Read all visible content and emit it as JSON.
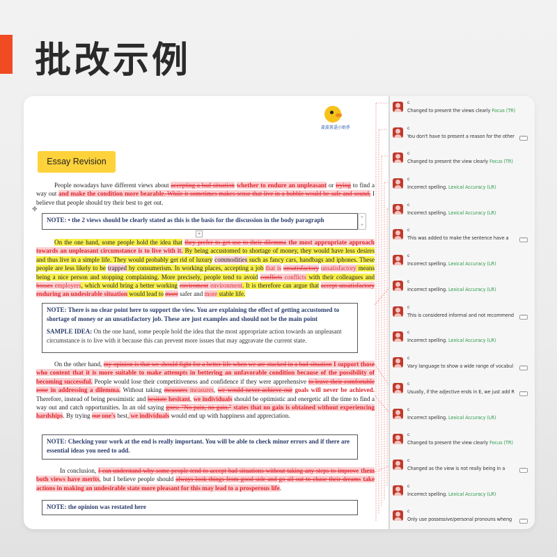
{
  "page_title": "批改示例",
  "colors": {
    "accent": "#f04b23",
    "deleted_text": "#e0232b",
    "highlight": "#f8f04a",
    "tag_green": "#2d9b4b",
    "tag_yellow": "#fed23a"
  },
  "logo": {
    "text": "皮皮英语小助手",
    "icon": "duck-mascot-icon"
  },
  "essay_tag": "Essay Revision",
  "doc": {
    "p1": {
      "a": "People nowadays have different views about",
      "d1": "accepting a bad situation",
      "i1": "whether to endure an unpleasant",
      "b": " or",
      "d2": "trying",
      "c": " to find a way out",
      "i2": "and make the condition more bearable",
      "d3": ". While it sometimes makes sense that live in a bubble would be safe and sound,",
      "e": " I believe that people should try their best to get out."
    },
    "note1": "NOTE: • the 2 views should be clearly stated as this is the basis for the discussion in the body paragraph",
    "p2": {
      "a": "On the one hand, some people hold the idea that",
      "d1": "they prefer to get use to their dilemma",
      "i1": " the most appropriate approach towards an unpleasant circumstance is to live with it.",
      "b": " By being accustomed to shortage of money, they would have less desires and thus live in a simple life. They would probably get rid of luxury",
      "d2": "commodities",
      "c": " such as fancy cars, handbags and iphones. These people are less likely to be",
      "d3": "trapped",
      "e": " by consumerism. In working places, accepting a job",
      "i2": "that is",
      "d4": "unsatisfactory",
      "i3": "unsatisfactory",
      "f": " means being a nice person and stopping complaining. More precisely, people tend to avoid",
      "d5": "conflicts",
      "i4": " conflicts",
      "g": " with their colleagues and",
      "d6": "bosses",
      "i5": " employers",
      "h": ", which would bring a better working",
      "d7": "enviroment",
      "i6": " environment",
      "j": ". It is therefore can argue that",
      "d8": "accept unsatisfactory",
      "i7": " enduring an undesirable situation",
      "k": " would lead to",
      "d9": "more",
      "l": " safer and",
      "i8": "more",
      "m": " stable life."
    },
    "note2": {
      "text": "NOTE: There is no clear point here to support the view. You are explaining the effect of getting accustomed to shortage of money or an unsatisfactory job. These are just examples and should not be the main point",
      "sample_label": "SAMPLE IDEA:",
      "sample_text": " On the one hand, some people hold the idea that the most appropriate action towards an unpleasant circumstance is to live with it because this can prevent more issues that may aggravate the current state."
    },
    "p3": {
      "a": "On the other hand,",
      "d1": "my opinion is that we should fight for a better life when we are stucked in a bad situation",
      "i1": " I support those who content that it is more suitable to make attempts in bettering an unfavorable condition because of the possibility of becoming successful.",
      "b": " People would lose their competitiveness and confidence if they were apprehensive",
      "d2": "to leave their comfortable zone",
      "i2": " in addressing a dilemma.",
      "c": " Without taking",
      "d3": "measures",
      "i3": " measures",
      "e": ",",
      "d4": "we would never achieve our",
      "f": " goals will never be achieved.",
      "g": " Therefore, instead of being pessimistic and",
      "d5": "hesitate",
      "i4": " hesitant",
      "h": ",",
      "i5": "we individuals",
      "j": " should be optimistic and energetic all the time to find a way out and catch opportunities. In an old saying",
      "d6": "goes: \"No pain, no gain.\"",
      "i6": " states that no gain is obtained without experiencing hardships",
      "k": ". By trying",
      "d7": "our",
      "i7": " one's",
      "l": " best,",
      "i8": " we individuals",
      "m": " would end up with happiness and appreciation."
    },
    "note3": "NOTE: Checking your work at the end is really important. You will be able to check minor errors and if there are essential ideas you need to add.",
    "p4": {
      "a": "In conclusion,",
      "d1": "I can understand why some people tend to accept bad situations without taking any steps to improve",
      "i1": " them both views have merits",
      "b": ", but I believe people should",
      "d2": "always look things from good side and go all out to chase their dreams",
      "i2": " take actions in making an undesirable state more pleasant for this may lead to a prosperous life",
      "c": "."
    },
    "note4": "NOTE: the opinion was restated here"
  },
  "comments": [
    {
      "author": "c",
      "text": "Changed to present the views clearly ",
      "tag": "Focus (TR)",
      "more": false
    },
    {
      "author": "c",
      "text": "You don't have to present a reason for the other ",
      "tag": "",
      "more": true
    },
    {
      "author": "c",
      "text": "Changed to present the view clearly ",
      "tag": "Focus (TR)",
      "more": false
    },
    {
      "author": "c",
      "text": "Incorrect spelling. ",
      "tag": "Lexical Accuracy (LR)",
      "more": false
    },
    {
      "author": "c",
      "text": "Incorrect spelling. ",
      "tag": "Lexical Accuracy (LR)",
      "more": false
    },
    {
      "author": "c",
      "text": "This was added to make the sentence have a ",
      "tag": "",
      "more": true
    },
    {
      "author": "c",
      "text": "Incorrect spelling. ",
      "tag": "Lexical Accuracy (LR)",
      "more": false
    },
    {
      "author": "c",
      "text": "Incorrect spelling. ",
      "tag": "Lexical Accuracy (LR)",
      "more": false
    },
    {
      "author": "c",
      "text": "This is considered informal and not recommend",
      "tag": "",
      "more": true
    },
    {
      "author": "c",
      "text": "Incorrect spelling. ",
      "tag": "Lexical Accuracy (LR)",
      "more": false
    },
    {
      "author": "c",
      "text": "Vary language to show a wide range of vocabul",
      "tag": "",
      "more": true
    },
    {
      "author": "c",
      "text": "Usually, if the adjective ends in E, we just add R",
      "tag": "",
      "more": true
    },
    {
      "author": "c",
      "text": "Incorrect spelling. ",
      "tag": "Lexical Accuracy (LR)",
      "more": false
    },
    {
      "author": "c",
      "text": "Changed to present the view clearly ",
      "tag": "Focus (TR)",
      "more": false
    },
    {
      "author": "c",
      "text": "Changed as the view is not really being in a",
      "tag": "",
      "more": true
    },
    {
      "author": "c",
      "text": "Incorrect spelling. ",
      "tag": "Lexical Accuracy (LR)",
      "more": false
    },
    {
      "author": "c",
      "text": "Only use possessive/personal pronouns wheng",
      "tag": "",
      "more": true
    }
  ]
}
